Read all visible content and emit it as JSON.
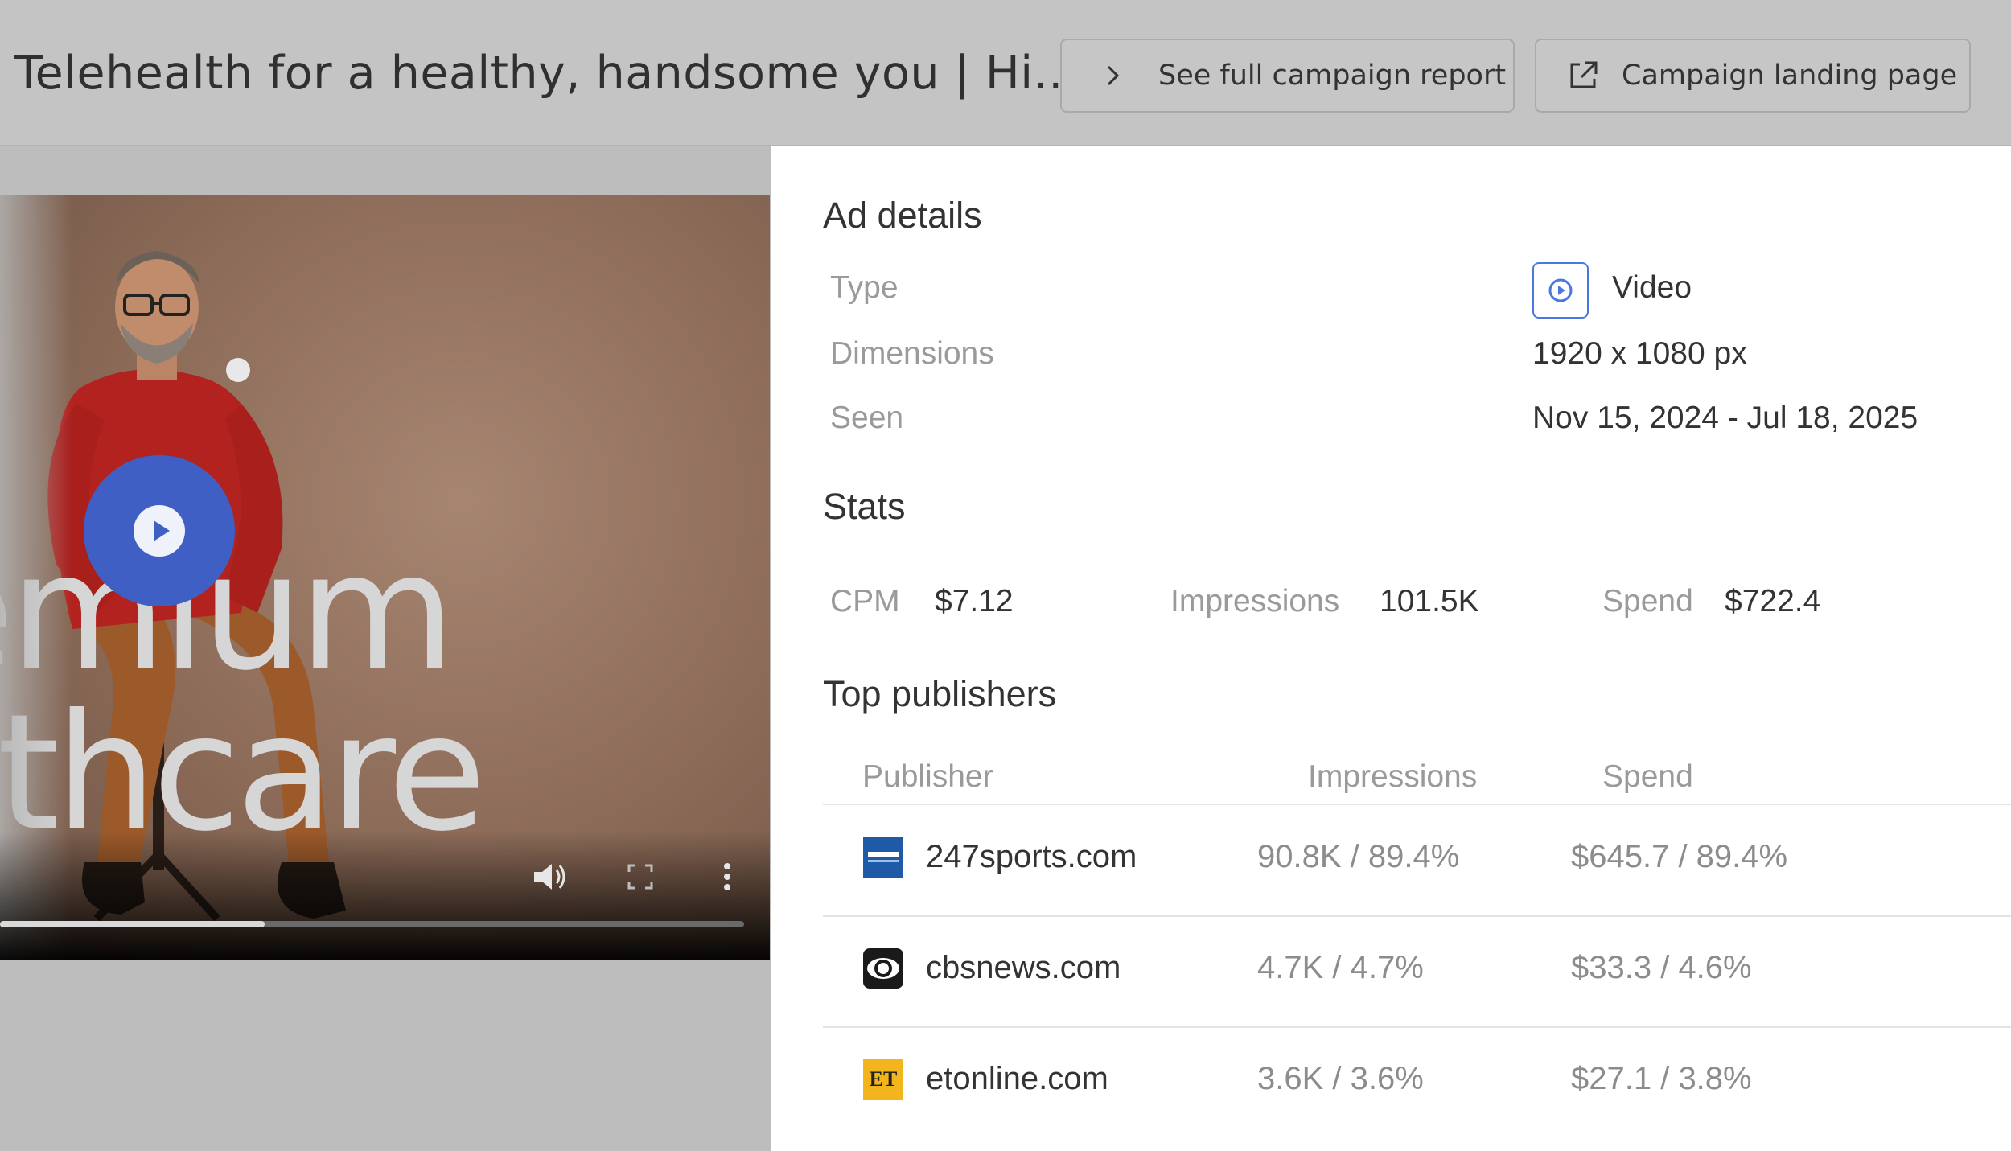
{
  "header": {
    "title": "Telehealth for a healthy, handsome you | Hi...",
    "report_button": "See full campaign report",
    "landing_button": "Campaign landing page"
  },
  "video": {
    "overlay_line1": "emium",
    "overlay_line2": "althcare",
    "progress": 0.356,
    "icons": [
      "play-icon",
      "volume-icon",
      "fullscreen-icon",
      "more-options-icon"
    ]
  },
  "ad_details": {
    "title": "Ad details",
    "type_label": "Type",
    "type_value": "Video",
    "dimensions_label": "Dimensions",
    "dimensions_value": "1920 x 1080 px",
    "seen_label": "Seen",
    "seen_value": "Nov 15, 2024 - Jul 18, 2025"
  },
  "stats": {
    "title": "Stats",
    "cpm_label": "CPM",
    "cpm_value": "$7.12",
    "impressions_label": "Impressions",
    "impressions_value": "101.5K",
    "spend_label": "Spend",
    "spend_value": "$722.4"
  },
  "top_publishers": {
    "title": "Top publishers",
    "columns": [
      "Publisher",
      "Impressions",
      "Spend"
    ],
    "rows": [
      {
        "name": "247sports.com",
        "impressions": "90.8K / 89.4%",
        "spend": "$645.7 / 89.4%",
        "logo": "247sports-logo",
        "logo_color": "#1f5aa6"
      },
      {
        "name": "cbsnews.com",
        "impressions": "4.7K / 4.7%",
        "spend": "$33.3 / 4.6%",
        "logo": "cbs-eye-logo",
        "logo_color": "#1a1a1a"
      },
      {
        "name": "etonline.com",
        "impressions": "3.6K / 3.6%",
        "spend": "$27.1 / 3.8%",
        "logo": "et-logo",
        "logo_text": "ET",
        "logo_color": "#f2b51c"
      }
    ]
  },
  "colors": {
    "accent_blue": "#3f5fc4",
    "icon_blue": "#4a78e0",
    "header_bg": "#c4c4c4"
  }
}
